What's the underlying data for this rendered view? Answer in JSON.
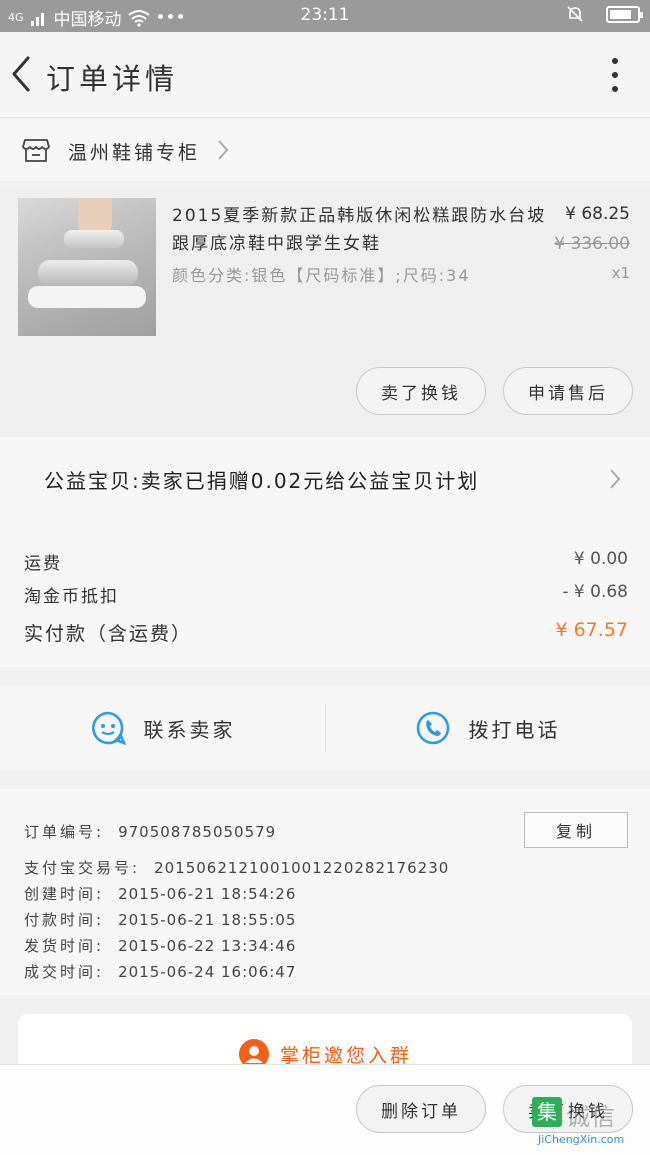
{
  "status_bar": {
    "carrier": "中国移动",
    "signal_label": "4G",
    "more": "•••",
    "time": "23:11"
  },
  "header": {
    "title": "订单详情"
  },
  "shop": {
    "name": "温州鞋铺专柜"
  },
  "product": {
    "name": "2015夏季新款正品韩版休闲松糕跟防水台坡跟厚底凉鞋中跟学生女鞋",
    "spec": "颜色分类:银色【尺码标准】;尺码:34",
    "price": "¥ 68.25",
    "original_price": "¥ 336.00",
    "quantity": "x1",
    "btn_buy_again": "卖了换钱",
    "btn_after_sale": "申请售后"
  },
  "charity": {
    "text": "公益宝贝:卖家已捐赠0.02元给公益宝贝计划"
  },
  "costs": [
    {
      "label": "运费",
      "value": "¥ 0.00"
    },
    {
      "label": "淘金币抵扣",
      "value": "- ¥ 0.68"
    },
    {
      "label": "实付款（含运费）",
      "value": "¥ 67.57"
    }
  ],
  "contact": {
    "seller": "联系卖家",
    "phone": "拨打电话"
  },
  "order_info": {
    "order_no_label": "订单编号:",
    "order_no": "970508785050579",
    "copy_label": "复制",
    "rows": [
      {
        "label": "支付宝交易号:",
        "value": "2015062121001001220282176230"
      },
      {
        "label": "创建时间:",
        "value": "2015-06-21 18:54:26"
      },
      {
        "label": "付款时间:",
        "value": "2015-06-21 18:55:05"
      },
      {
        "label": "发货时间:",
        "value": "2015-06-22 13:34:46"
      },
      {
        "label": "成交时间:",
        "value": "2015-06-24 16:06:47"
      }
    ]
  },
  "group_invite": {
    "text": "掌柜邀您入群"
  },
  "bottom_bar": {
    "delete": "删除订单",
    "buy_again": "卖了换钱"
  },
  "watermark": {
    "box": "集",
    "cn": "诚信",
    "url": "JiChengXin.com"
  },
  "colors": {
    "accent_orange": "#f27a2c",
    "icon_blue": "#2d9be6",
    "status_bar": "#9a9a9a"
  }
}
